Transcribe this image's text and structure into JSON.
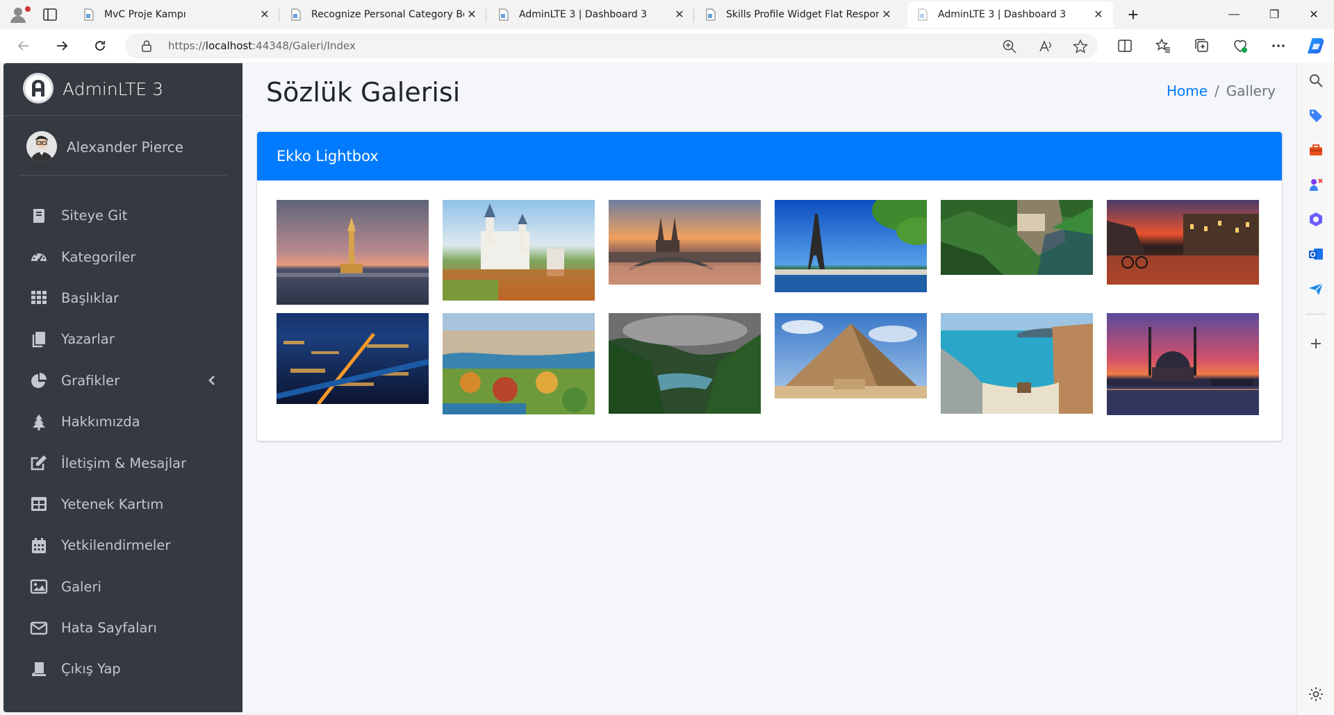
{
  "browser": {
    "tabs": [
      {
        "title": "MvC Proje Kampı",
        "active": false
      },
      {
        "title": "Recognize Personal Category Bo...",
        "active": false
      },
      {
        "title": "AdminLTE 3 | Dashboard 3",
        "active": false
      },
      {
        "title": "Skills Profile Widget Flat Respons...",
        "active": false
      },
      {
        "title": "AdminLTE 3 | Dashboard 3",
        "active": true
      }
    ],
    "url_prefix": "https://",
    "url_host": "localhost",
    "url_rest": ":44348/Galeri/Index",
    "icons": [
      "back-icon",
      "forward-icon",
      "refresh-icon",
      "lock-icon",
      "zoom-icon",
      "read-aloud-icon",
      "favorite-star-icon",
      "split-screen-icon",
      "favorites-icon",
      "collections-icon",
      "browser-essentials-icon",
      "more-icon",
      "copilot-icon"
    ]
  },
  "sidebar": {
    "brand": "AdminLTE 3",
    "user": "Alexander Pierce",
    "items": [
      {
        "label": "Siteye Git",
        "icon": "book-icon"
      },
      {
        "label": "Kategoriler",
        "icon": "tachometer-icon"
      },
      {
        "label": "Başlıklar",
        "icon": "th-icon"
      },
      {
        "label": "Yazarlar",
        "icon": "copy-icon"
      },
      {
        "label": "Grafikler",
        "icon": "chart-pie-icon",
        "expandable": true
      },
      {
        "label": "Hakkımızda",
        "icon": "tree-icon"
      },
      {
        "label": "İletişim & Mesajlar",
        "icon": "edit-icon"
      },
      {
        "label": "Yetenek Kartım",
        "icon": "table-icon"
      },
      {
        "label": "Yetkilendirmeler",
        "icon": "calendar-icon"
      },
      {
        "label": "Galeri",
        "icon": "image-icon"
      },
      {
        "label": "Hata Sayfaları",
        "icon": "envelope-icon"
      },
      {
        "label": "Çıkış Yap",
        "icon": "user-icon"
      }
    ]
  },
  "content": {
    "title": "Sözlük Galerisi",
    "breadcrumb": {
      "home": "Home",
      "separator": "/",
      "current": "Gallery"
    },
    "card_title": "Ekko Lightbox",
    "images": [
      "maidens-tower-istanbul",
      "neuschwanstein-castle",
      "cologne-cathedral",
      "eiffel-tower",
      "sumela-monastery",
      "amsterdam-canal",
      "city-night-aerial",
      "stockholm-aerial",
      "green-mountain-lake",
      "giza-pyramid",
      "beach-cliff",
      "ortakoy-mosque"
    ]
  },
  "colors": {
    "primary": "#007bff",
    "sidebar": "#343a40",
    "content_bg": "#f4f6f9"
  }
}
